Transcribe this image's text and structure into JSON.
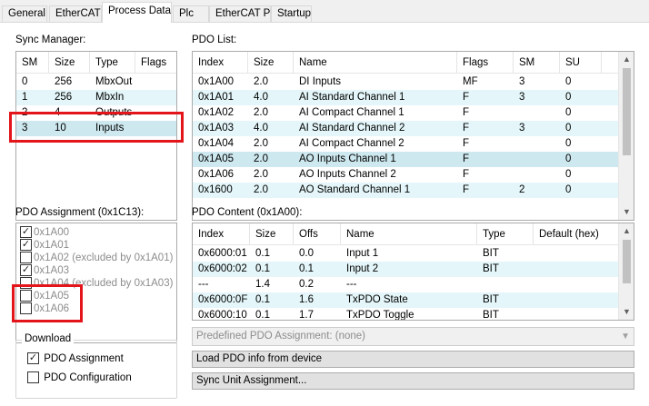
{
  "tabs": [
    "General",
    "EtherCAT",
    "Process Data",
    "Plc",
    "EtherCAT P",
    "Startup"
  ],
  "sync_manager": {
    "caption": "Sync Manager:",
    "columns": [
      "SM",
      "Size",
      "Type",
      "Flags"
    ],
    "rows": [
      [
        "0",
        "256",
        "MbxOut",
        ""
      ],
      [
        "1",
        "256",
        "MbxIn",
        ""
      ],
      [
        "2",
        "4",
        "Outputs",
        ""
      ],
      [
        "3",
        "10",
        "Inputs",
        ""
      ]
    ]
  },
  "pdo_list": {
    "caption": "PDO List:",
    "columns": [
      "Index",
      "Size",
      "Name",
      "Flags",
      "SM",
      "SU"
    ],
    "rows": [
      [
        "0x1A00",
        "2.0",
        "DI Inputs",
        "MF",
        "3",
        "0"
      ],
      [
        "0x1A01",
        "4.0",
        "AI Standard Channel 1",
        "F",
        "3",
        "0"
      ],
      [
        "0x1A02",
        "2.0",
        "AI Compact Channel 1",
        "F",
        "",
        "0"
      ],
      [
        "0x1A03",
        "4.0",
        "AI Standard Channel 2",
        "F",
        "3",
        "0"
      ],
      [
        "0x1A04",
        "2.0",
        "AI Compact Channel 2",
        "F",
        "",
        "0"
      ],
      [
        "0x1A05",
        "2.0",
        "AO Inputs Channel 1",
        "F",
        "",
        "0"
      ],
      [
        "0x1A06",
        "2.0",
        "AO Inputs Channel 2",
        "F",
        "",
        "0"
      ],
      [
        "0x1600",
        "2.0",
        "AO Standard Channel 1",
        "F",
        "2",
        "0"
      ]
    ]
  },
  "pdo_assignment": {
    "caption": "PDO Assignment (0x1C13):",
    "items": [
      {
        "label": "0x1A00",
        "checked": true
      },
      {
        "label": "0x1A01",
        "checked": true
      },
      {
        "label": "0x1A02 (excluded by 0x1A01)",
        "checked": false
      },
      {
        "label": "0x1A03",
        "checked": true
      },
      {
        "label": "0x1A04 (excluded by 0x1A03)",
        "checked": false
      },
      {
        "label": "0x1A05",
        "checked": false
      },
      {
        "label": "0x1A06",
        "checked": false
      }
    ]
  },
  "pdo_content": {
    "caption": "PDO Content (0x1A00):",
    "columns": [
      "Index",
      "Size",
      "Offs",
      "Name",
      "Type",
      "Default (hex)"
    ],
    "rows": [
      [
        "0x6000:01",
        "0.1",
        "0.0",
        "Input 1",
        "BIT",
        ""
      ],
      [
        "0x6000:02",
        "0.1",
        "0.1",
        "Input 2",
        "BIT",
        ""
      ],
      [
        "---",
        "1.4",
        "0.2",
        "---",
        "",
        ""
      ],
      [
        "0x6000:0F",
        "0.1",
        "1.6",
        "TxPDO State",
        "BIT",
        ""
      ],
      [
        "0x6000:10",
        "0.1",
        "1.7",
        "TxPDO Toggle",
        "BIT",
        ""
      ]
    ]
  },
  "download": {
    "legend": "Download",
    "pdo_assignment_label": "PDO Assignment",
    "pdo_assignment_checked": true,
    "pdo_configuration_label": "PDO Configuration",
    "pdo_configuration_checked": false
  },
  "predefined": {
    "value": "Predefined PDO Assignment: (none)"
  },
  "buttons": {
    "load_pdo": "Load PDO info from device",
    "sync_unit": "Sync Unit Assignment..."
  },
  "colors": {
    "highlight": "#e4141b",
    "alt_row": "#e4f6f9"
  }
}
